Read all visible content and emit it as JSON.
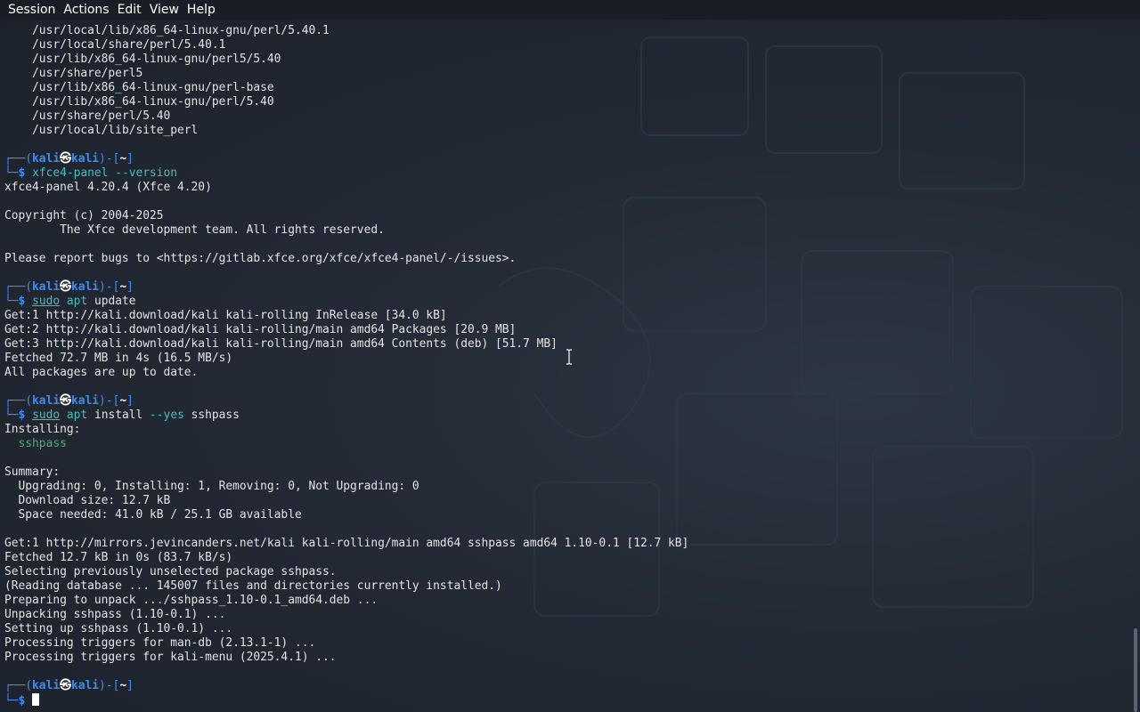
{
  "menubar": {
    "items": [
      "Session",
      "Actions",
      "Edit",
      "View",
      "Help"
    ]
  },
  "terminal": {
    "perl_paths": [
      "/usr/local/lib/x86_64-linux-gnu/perl/5.40.1",
      "/usr/local/share/perl/5.40.1",
      "/usr/lib/x86_64-linux-gnu/perl5/5.40",
      "/usr/share/perl5",
      "/usr/lib/x86_64-linux-gnu/perl-base",
      "/usr/lib/x86_64-linux-gnu/perl/5.40",
      "/usr/share/perl/5.40",
      "/usr/local/lib/site_perl"
    ],
    "prompt": {
      "top_left": "┌──(",
      "user": "kali",
      "at": "㉿",
      "host": "kali",
      "mid": ")-[",
      "dir": "~",
      "end": "]",
      "bottom": "└─",
      "dollar": "$"
    },
    "cmd1": {
      "cmd": "xfce4-panel",
      "opt": "--version"
    },
    "out1": [
      "xfce4-panel 4.20.4 (Xfce 4.20)",
      "",
      "Copyright (c) 2004-2025",
      "        The Xfce development team. All rights reserved.",
      "",
      "Please report bugs to <https://gitlab.xfce.org/xfce/xfce4-panel/-/issues>."
    ],
    "cmd2": {
      "sudo": "sudo",
      "apt": "apt",
      "arg": "update"
    },
    "out2": [
      "Get:1 http://kali.download/kali kali-rolling InRelease [34.0 kB]",
      "Get:2 http://kali.download/kali kali-rolling/main amd64 Packages [20.9 MB]",
      "Get:3 http://kali.download/kali kali-rolling/main amd64 Contents (deb) [51.7 MB]",
      "Fetched 72.7 MB in 4s (16.5 MB/s)",
      "All packages are up to date."
    ],
    "cmd3": {
      "sudo": "sudo",
      "apt": "apt",
      "arg1": "install",
      "opt": "--yes",
      "arg2": "sshpass"
    },
    "out3_installing": "Installing:",
    "out3_pkg": "  sshpass",
    "out3_summary": [
      "Summary:",
      "  Upgrading: 0, Installing: 1, Removing: 0, Not Upgrading: 0",
      "  Download size: 12.7 kB",
      "  Space needed: 41.0 kB / 25.1 GB available"
    ],
    "out3_log": [
      "Get:1 http://mirrors.jevincanders.net/kali kali-rolling/main amd64 sshpass amd64 1.10-0.1 [12.7 kB]",
      "Fetched 12.7 kB in 0s (83.7 kB/s)",
      "Selecting previously unselected package sshpass.",
      "(Reading database ... 145007 files and directories currently installed.)",
      "Preparing to unpack .../sshpass_1.10-0.1_amd64.deb ...",
      "Unpacking sshpass (1.10-0.1) ...",
      "Setting up sshpass (1.10-0.1) ...",
      "Processing triggers for man-db (2.13.1-1) ...",
      "Processing triggers for kali-menu (2025.4.1) ..."
    ]
  },
  "colors": {
    "prompt_blue": "#3a8df5",
    "command_cyan": "#3fbfbf",
    "background": "#1f2631",
    "menubar_bg": "#1a1e24"
  }
}
